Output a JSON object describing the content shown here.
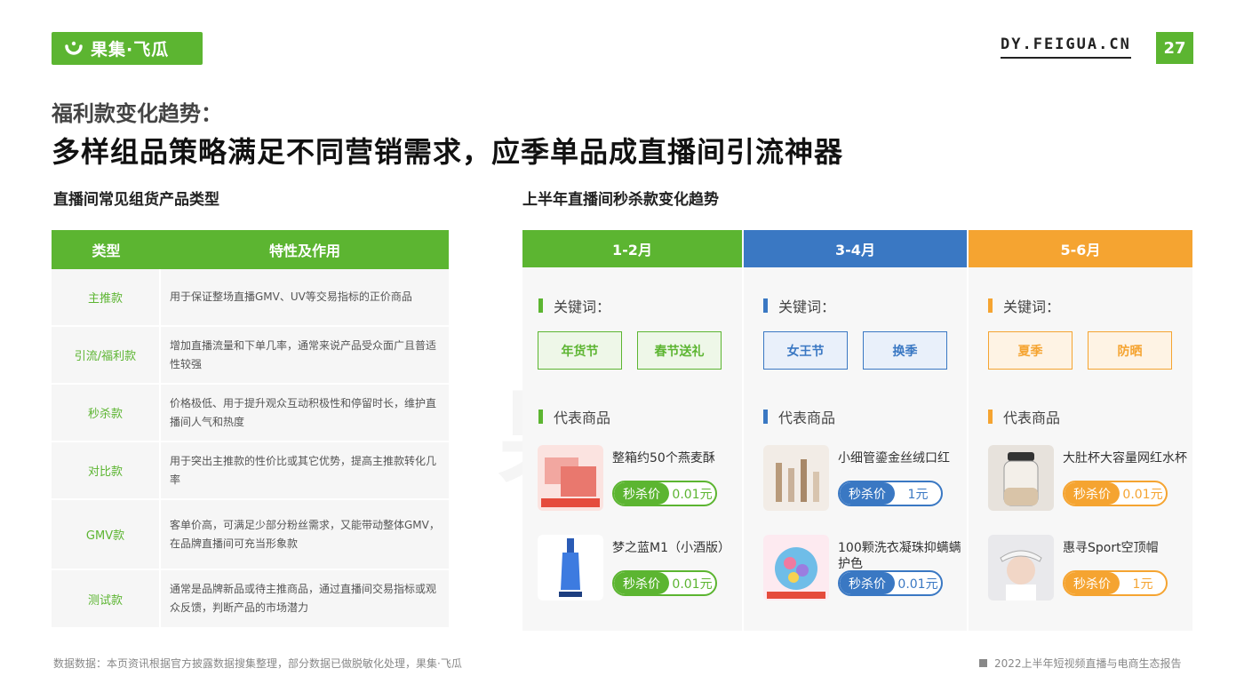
{
  "brand": {
    "logo_text": "果集·飞瓜",
    "site": "DY.FEIGUA.CN",
    "page_number": "27",
    "accent": "#5cb531"
  },
  "header": {
    "subtitle": "福利款变化趋势：",
    "title": "多样组品策略满足不同营销需求，应季单品成直播间引流神器"
  },
  "left": {
    "section_title": "直播间常见组货产品类型",
    "columns": [
      "类型",
      "特性及作用"
    ],
    "rows": [
      {
        "type": "主推款",
        "desc": "用于保证整场直播GMV、UV等交易指标的正价商品"
      },
      {
        "type": "引流/福利款",
        "desc": "增加直播流量和下单几率，通常来说产品受众面广且普适性较强"
      },
      {
        "type": "秒杀款",
        "desc": "价格极低、用于提升观众互动积极性和停留时长，维护直播间人气和热度"
      },
      {
        "type": "对比款",
        "desc": "用于突出主推款的性价比或其它优势，提高主推款转化几率"
      },
      {
        "type": "GMV款",
        "desc": "客单价高，可满足少部分粉丝需求，又能带动整体GMV，在品牌直播间可充当形象款"
      },
      {
        "type": "测试款",
        "desc": "通常是品牌新品或待主推商品，通过直播间交易指标或观众反馈，判断产品的市场潜力"
      }
    ]
  },
  "right": {
    "section_title": "上半年直播间秒杀款变化趋势",
    "keyword_label": "关键词：",
    "product_label": "代表商品",
    "price_tag": "秒杀价",
    "periods": [
      {
        "name": "1-2月",
        "color": "#5cb531",
        "keywords": [
          "年货节",
          "春节送礼"
        ],
        "products": [
          {
            "name": "整箱约50个燕麦酥",
            "price": "0.01元"
          },
          {
            "name": "梦之蓝M1（小酒版）",
            "price": "0.01元"
          }
        ]
      },
      {
        "name": "3-4月",
        "color": "#3a78c3",
        "keywords": [
          "女王节",
          "换季"
        ],
        "products": [
          {
            "name": "小细管鎏金丝绒口红",
            "price": "1元"
          },
          {
            "name": "100颗洗衣凝珠抑螨螨护色",
            "price": "0.01元"
          }
        ]
      },
      {
        "name": "5-6月",
        "color": "#f5a431",
        "keywords": [
          "夏季",
          "防晒"
        ],
        "products": [
          {
            "name": "大肚杯大容量网红水杯",
            "price": "0.01元"
          },
          {
            "name": "惠寻Sport空顶帽",
            "price": "1元"
          }
        ]
      }
    ]
  },
  "footer": {
    "source": "数据数据：本页资讯根据官方披露数据搜集整理，部分数据已做脱敏化处理，果集·飞瓜",
    "report": "2022上半年短视频直播与电商生态报告"
  }
}
